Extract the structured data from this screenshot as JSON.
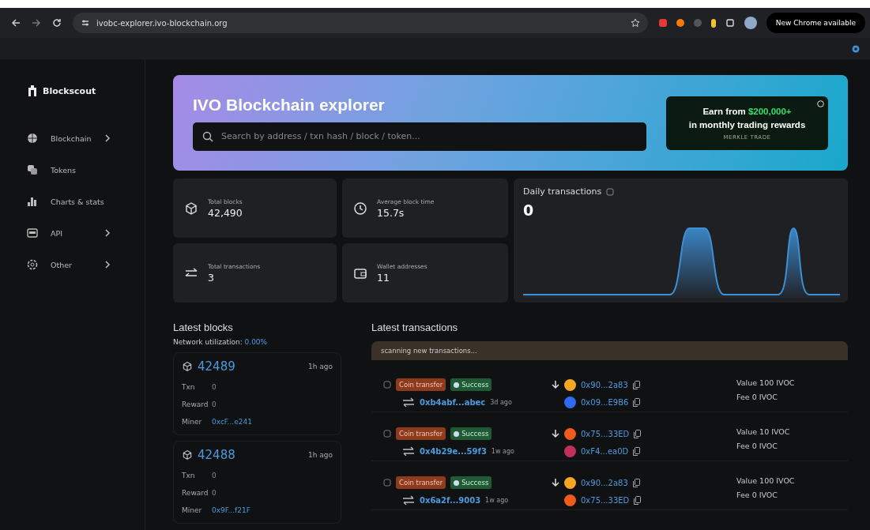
{
  "browser": {
    "url": "ivobc-explorer.ivo-blockchain.org",
    "update_button": "New Chrome available"
  },
  "sidebar": {
    "logo": "Blockscout",
    "items": [
      {
        "label": "Blockchain",
        "expandable": true
      },
      {
        "label": "Tokens",
        "expandable": false
      },
      {
        "label": "Charts & stats",
        "expandable": false
      },
      {
        "label": "API",
        "expandable": true
      },
      {
        "label": "Other",
        "expandable": true
      }
    ]
  },
  "hero": {
    "title": "IVO Blockchain explorer",
    "search": {
      "placeholder": "Search by address / txn hash / block / token..."
    },
    "ad": {
      "text_before": "Earn from ",
      "amount": "$200,000+",
      "text_after": "in monthly trading rewards",
      "brand": "MERKLE TRADE"
    }
  },
  "stats": [
    {
      "label": "Total blocks",
      "value": "42,490"
    },
    {
      "label": "Average block time",
      "value": "15.7s"
    },
    {
      "label": "Total transactions",
      "value": "3"
    },
    {
      "label": "Wallet addresses",
      "value": "11"
    }
  ],
  "daily_transactions": {
    "title": "Daily transactions",
    "value": "0"
  },
  "latest_blocks": {
    "title": "Latest blocks",
    "utilization_label": "Network utilization: ",
    "utilization": "0.00%",
    "blocks": [
      {
        "number": "42489",
        "age": "1h ago",
        "txn_label": "Txn",
        "txn": "0",
        "reward_label": "Reward",
        "reward": "0",
        "miner_label": "Miner",
        "miner": "0xcF...e241"
      },
      {
        "number": "42488",
        "age": "1h ago",
        "txn_label": "Txn",
        "txn": "0",
        "reward_label": "Reward",
        "reward": "0",
        "miner_label": "Miner",
        "miner": "0x9F...f21F"
      }
    ]
  },
  "latest_transactions": {
    "title": "Latest transactions",
    "notice": "scanning new transactions...",
    "rows": [
      {
        "type": "Coin transfer",
        "status": "Success",
        "hash": "0xb4abf...abec",
        "age": "3d ago",
        "from": "0x90...2a83",
        "to": "0x09...E9B6",
        "value": "Value 100 IVOC",
        "fee": "Fee 0 IVOC"
      },
      {
        "type": "Coin transfer",
        "status": "Success",
        "hash": "0x4b29e...59f3",
        "age": "1w ago",
        "from": "0x75...33ED",
        "to": "0xF4...ea0D",
        "value": "Value 10 IVOC",
        "fee": "Fee 0 IVOC"
      },
      {
        "type": "Coin transfer",
        "status": "Success",
        "hash": "0x6a2f...9003",
        "age": "1w ago",
        "from": "0x90...2a83",
        "to": "0x75...33ED",
        "value": "Value 100 IVOC",
        "fee": "Fee 0 IVOC"
      }
    ]
  }
}
